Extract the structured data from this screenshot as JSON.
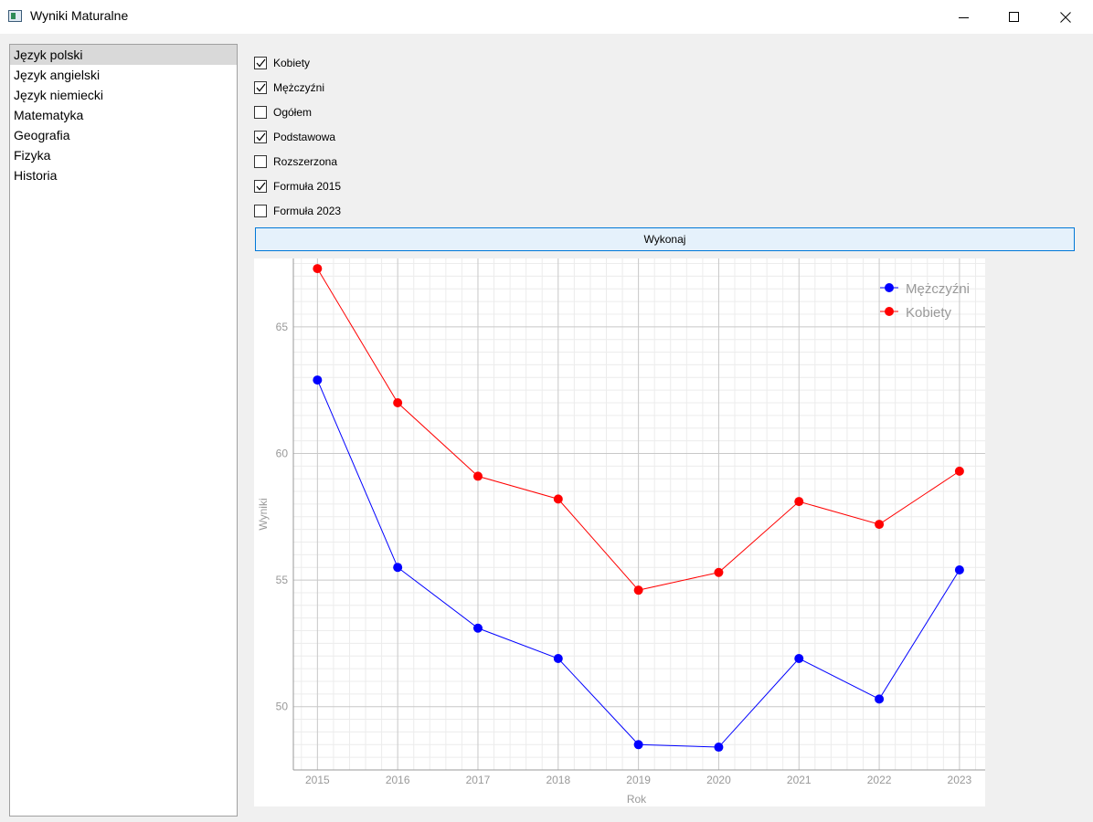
{
  "window": {
    "title": "Wyniki Maturalne"
  },
  "subjects": [
    "Język polski",
    "Język angielski",
    "Język niemiecki",
    "Matematyka",
    "Geografia",
    "Fizyka",
    "Historia"
  ],
  "selected_subject": "Język polski",
  "filters": [
    {
      "label": "Kobiety",
      "checked": true
    },
    {
      "label": "Mężczyźni",
      "checked": true
    },
    {
      "label": "Ogółem",
      "checked": false
    },
    {
      "label": "Podstawowa",
      "checked": true
    },
    {
      "label": "Rozszerzona",
      "checked": false
    },
    {
      "label": "Formuła 2015",
      "checked": true
    },
    {
      "label": "Formuła 2023",
      "checked": false
    }
  ],
  "execute_button": "Wykonaj",
  "chart_data": {
    "type": "line",
    "xlabel": "Rok",
    "ylabel": "Wyniki",
    "x": [
      2015,
      2016,
      2017,
      2018,
      2019,
      2020,
      2021,
      2022,
      2023
    ],
    "xlim": [
      2014.7,
      2023.32
    ],
    "ylim": [
      47.5,
      67.7
    ],
    "yticks": [
      50,
      55,
      60,
      65
    ],
    "grid": true,
    "legend_position": "top-right",
    "series": [
      {
        "name": "Mężczyźni",
        "color": "#0000ff",
        "values": [
          62.9,
          55.5,
          53.1,
          51.9,
          48.5,
          48.4,
          51.9,
          50.3,
          55.4
        ]
      },
      {
        "name": "Kobiety",
        "color": "#ff0000",
        "values": [
          67.3,
          62.0,
          59.1,
          58.2,
          54.6,
          55.3,
          58.1,
          57.2,
          59.3
        ]
      }
    ]
  }
}
